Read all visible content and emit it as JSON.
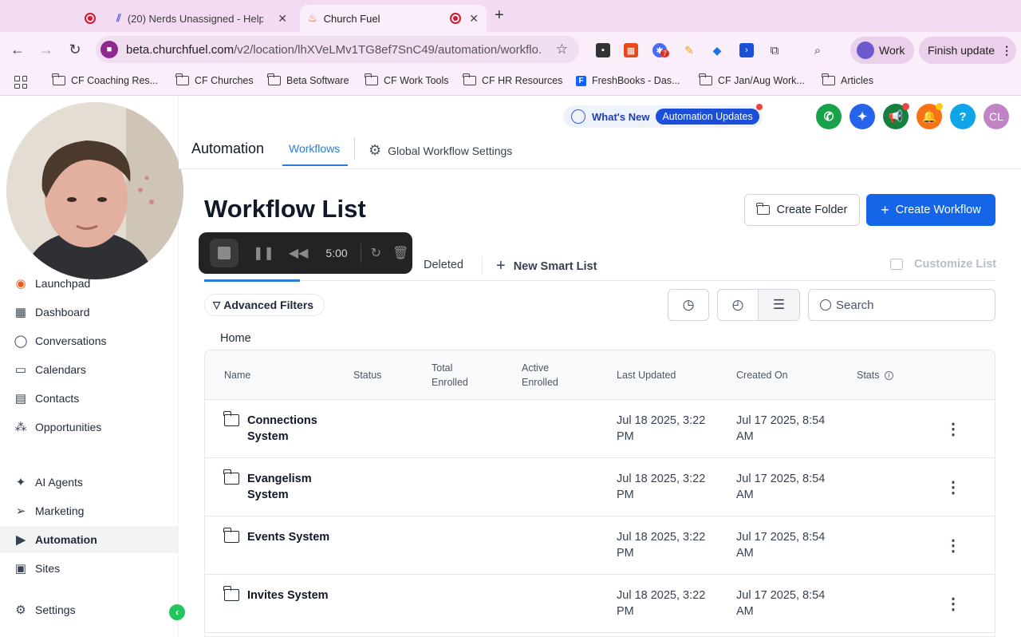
{
  "browser": {
    "tabs": [
      {
        "title": "(20) Nerds Unassigned - Help"
      },
      {
        "title": "Church Fuel"
      }
    ],
    "url_host": "beta.churchfuel.com",
    "url_path": "/v2/location/lhXVeLMv1TG8ef7SnC49/automation/workflo...",
    "extension_badge": "7",
    "profile_label": "Work",
    "update_label": "Finish update",
    "bookmarks": [
      "CF Coaching Res...",
      "CF Churches",
      "Beta Software",
      "CF Work Tools",
      "CF HR Resources",
      "FreshBooks - Das...",
      "CF Jan/Aug Work...",
      "Articles"
    ]
  },
  "header": {
    "whats_new_label": "What's New",
    "whats_new_pill": "Automation Updates",
    "user_initials": "CL",
    "help_symbol": "?",
    "section_title": "Automation",
    "tab_workflows": "Workflows",
    "tab_global": "Global Workflow Settings"
  },
  "sidebar": {
    "items": [
      {
        "label": "Launchpad",
        "icon": "launchpad-icon"
      },
      {
        "label": "Dashboard",
        "icon": "dashboard-icon"
      },
      {
        "label": "Conversations",
        "icon": "chat-icon"
      },
      {
        "label": "Calendars",
        "icon": "calendar-icon"
      },
      {
        "label": "Contacts",
        "icon": "contacts-icon"
      },
      {
        "label": "Opportunities",
        "icon": "opportunities-icon"
      },
      {
        "label": "AI Agents",
        "icon": "sparkle-icon"
      },
      {
        "label": "Marketing",
        "icon": "send-icon"
      },
      {
        "label": "Automation",
        "icon": "automation-icon"
      },
      {
        "label": "Sites",
        "icon": "sites-icon"
      },
      {
        "label": "Settings",
        "icon": "gear-icon"
      }
    ]
  },
  "recorder": {
    "time": "5:00"
  },
  "main": {
    "title": "Workflow List",
    "create_folder_label": "Create Folder",
    "create_workflow_label": "Create Workflow",
    "tab_deleted": "Deleted",
    "new_smart_list": "New Smart List",
    "customize_list": "Customize List",
    "advanced_filters": "Advanced Filters",
    "search_placeholder": "Search",
    "breadcrumb": "Home"
  },
  "table": {
    "columns": [
      "Name",
      "Status",
      "Total\nEnrolled",
      "Active\nEnrolled",
      "Last Updated",
      "Created On",
      "Stats"
    ],
    "rows": [
      {
        "name": "Connections System",
        "last_updated": "Jul 18 2025, 3:22 PM",
        "created_on": "Jul 17 2025, 8:54 AM"
      },
      {
        "name": "Evangelism System",
        "last_updated": "Jul 18 2025, 3:22 PM",
        "created_on": "Jul 17 2025, 8:54 AM"
      },
      {
        "name": "Events System",
        "last_updated": "Jul 18 2025, 3:22 PM",
        "created_on": "Jul 17 2025, 8:54 AM"
      },
      {
        "name": "Invites System",
        "last_updated": "Jul 18 2025, 3:22 PM",
        "created_on": "Jul 17 2025, 8:54 AM"
      }
    ]
  },
  "colors": {
    "primary": "#1565e8",
    "link": "#2b7bd8",
    "browser_chrome": "#f3dbf3"
  }
}
